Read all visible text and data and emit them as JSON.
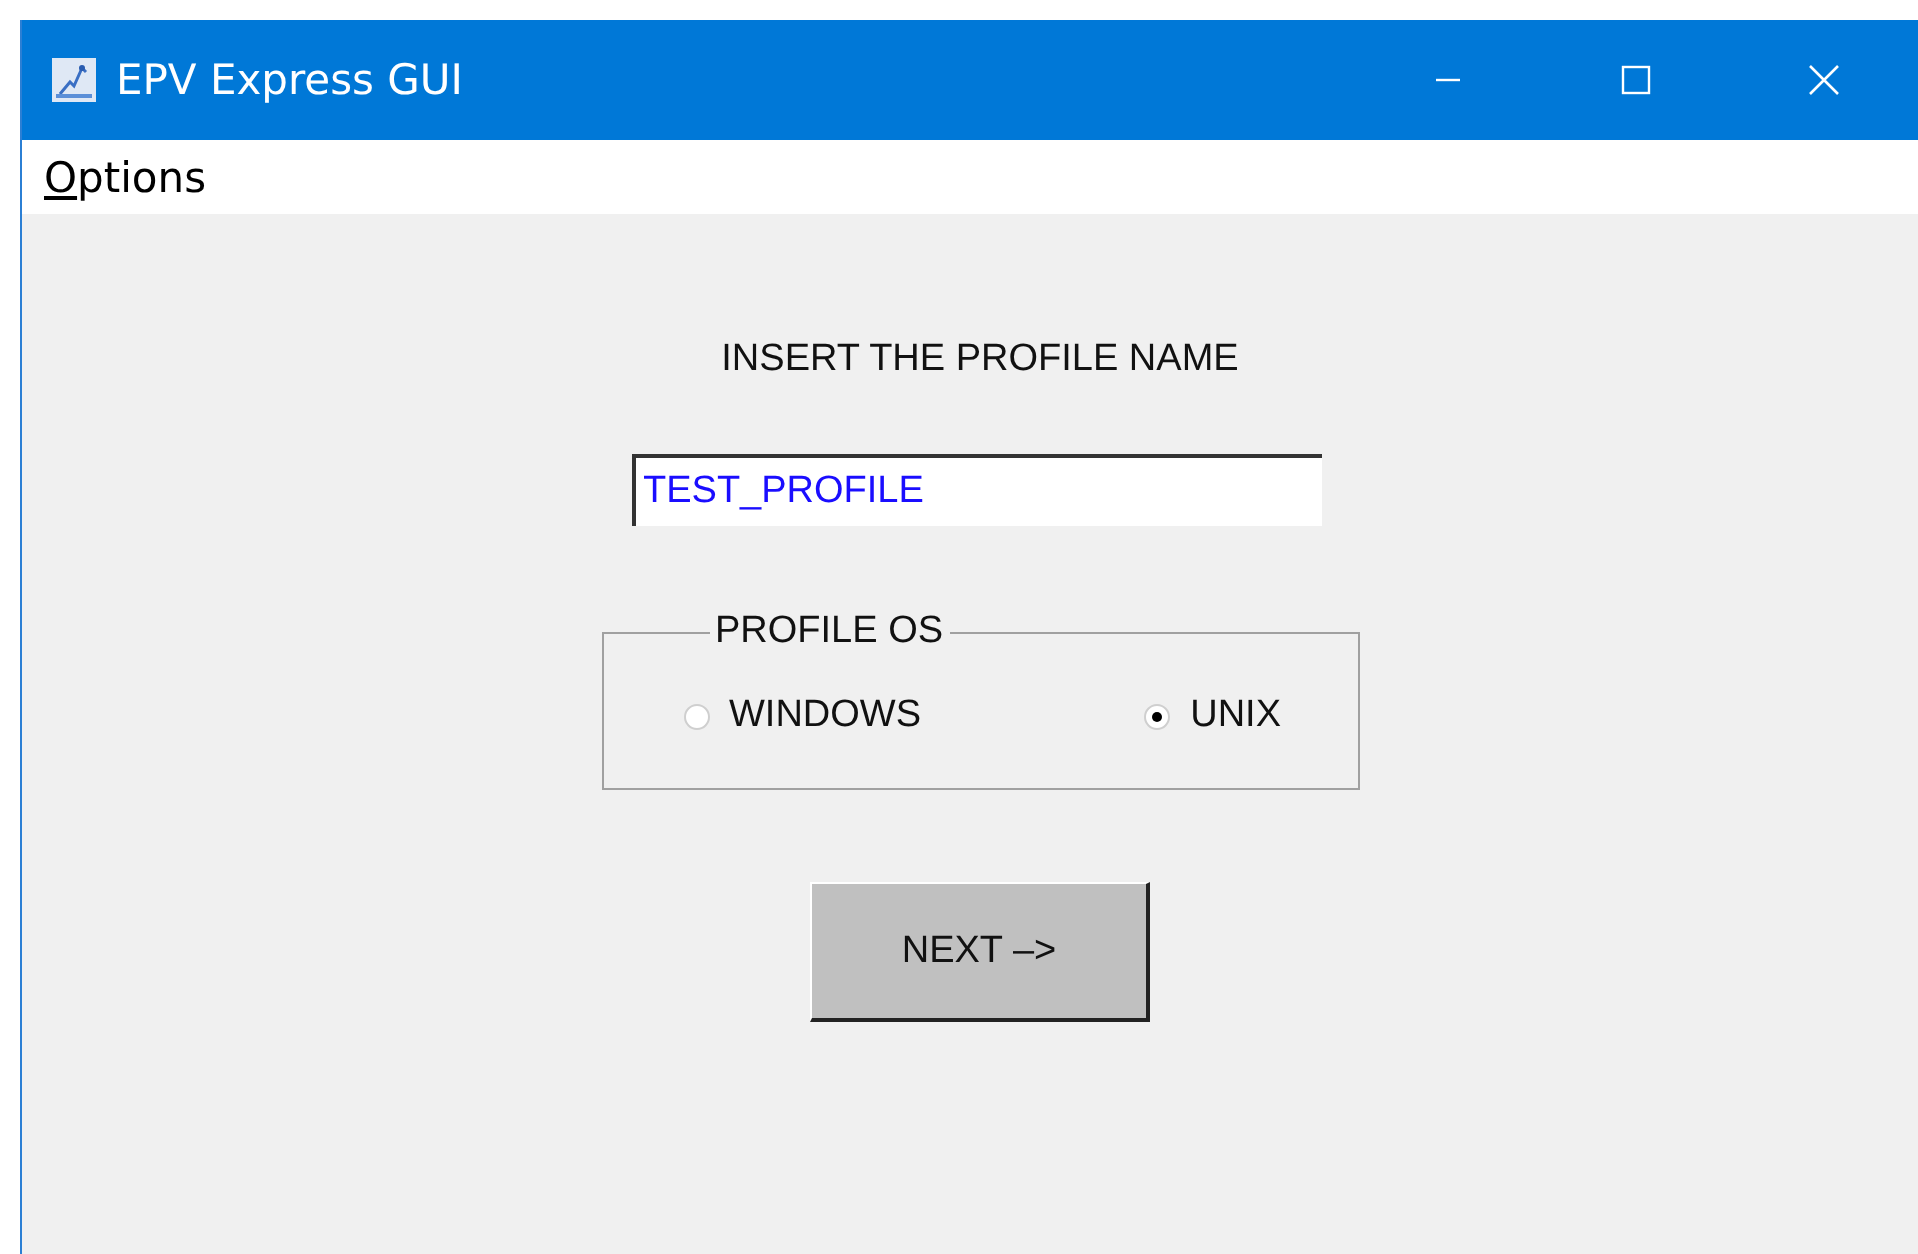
{
  "window": {
    "title": "EPV Express GUI"
  },
  "menu": [
    {
      "label": "Options"
    }
  ],
  "prompt": "INSERT THE PROFILE NAME",
  "profile_name": {
    "value": "TEST_PROFILE"
  },
  "profile_os": {
    "title": "PROFILE OS",
    "options": [
      {
        "label": "WINDOWS",
        "selected": false
      },
      {
        "label": "UNIX",
        "selected": true
      }
    ]
  },
  "buttons": [
    {
      "label": "NEXT –>"
    }
  ]
}
